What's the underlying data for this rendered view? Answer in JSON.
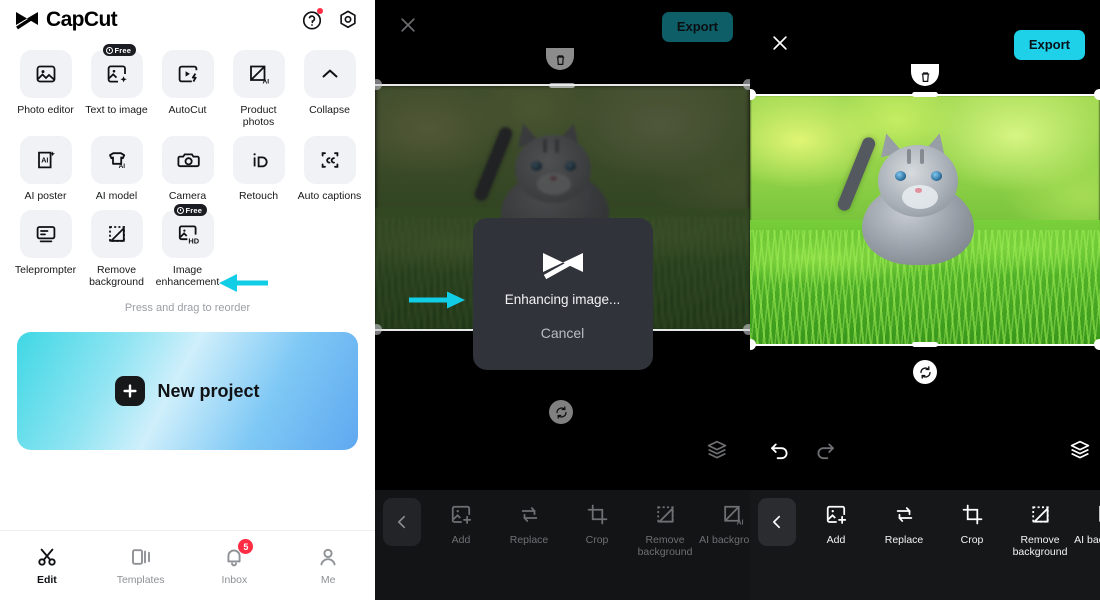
{
  "app": {
    "name": "CapCut"
  },
  "home": {
    "header": {
      "logo_text": "CapCut",
      "help_icon": "help-circle-icon",
      "settings_icon": "settings-hexagon-icon"
    },
    "tools": [
      {
        "label": "Photo editor",
        "icon": "photo-editor-icon",
        "badge": ""
      },
      {
        "label": "Text to image",
        "icon": "text-to-image-icon",
        "badge": "Free"
      },
      {
        "label": "AutoCut",
        "icon": "autocut-icon",
        "badge": ""
      },
      {
        "label": "Product photos",
        "icon": "product-photos-icon",
        "badge": ""
      },
      {
        "label": "Collapse",
        "icon": "chevron-up-icon",
        "badge": ""
      },
      {
        "label": "AI poster",
        "icon": "ai-poster-icon",
        "badge": ""
      },
      {
        "label": "AI model",
        "icon": "ai-model-icon",
        "badge": ""
      },
      {
        "label": "Camera",
        "icon": "camera-icon",
        "badge": ""
      },
      {
        "label": "Retouch",
        "icon": "retouch-icon",
        "badge": ""
      },
      {
        "label": "Auto captions",
        "icon": "auto-captions-icon",
        "badge": ""
      },
      {
        "label": "Teleprompter",
        "icon": "teleprompter-icon",
        "badge": ""
      },
      {
        "label": "Remove background",
        "icon": "remove-background-icon",
        "badge": ""
      },
      {
        "label": "Image enhancement",
        "icon": "image-enhancement-hd-icon",
        "badge": "Free"
      }
    ],
    "reorder_hint": "Press and drag to reorder",
    "new_project_label": "New project",
    "bottom_nav": [
      {
        "label": "Edit",
        "icon": "scissors-icon",
        "badge": "",
        "active": true
      },
      {
        "label": "Templates",
        "icon": "templates-icon",
        "badge": "",
        "active": false
      },
      {
        "label": "Inbox",
        "icon": "bell-icon",
        "badge": "5",
        "active": false
      },
      {
        "label": "Me",
        "icon": "person-icon",
        "badge": "",
        "active": false
      }
    ]
  },
  "editor_processing": {
    "close_label": "close-icon",
    "export_label": "Export",
    "modal": {
      "status_text": "Enhancing image...",
      "cancel_label": "Cancel",
      "logo_icon": "capcut-logo-icon"
    },
    "canvas_icons": [
      "layers-icon"
    ],
    "toolbar": [
      {
        "label": "Add",
        "icon": "add-image-icon"
      },
      {
        "label": "Replace",
        "icon": "replace-icon"
      },
      {
        "label": "Crop",
        "icon": "crop-icon"
      },
      {
        "label": "Remove background",
        "icon": "remove-background-icon"
      },
      {
        "label": "AI background",
        "icon": "ai-background-icon"
      }
    ],
    "back_icon": "chevron-left-icon"
  },
  "editor_result": {
    "close_label": "close-icon",
    "export_label": "Export",
    "canvas_icons": [
      "undo-icon",
      "redo-icon",
      "layers-icon"
    ],
    "toolbar": [
      {
        "label": "Add",
        "icon": "add-image-icon"
      },
      {
        "label": "Replace",
        "icon": "replace-icon"
      },
      {
        "label": "Crop",
        "icon": "crop-icon"
      },
      {
        "label": "Remove background",
        "icon": "remove-background-icon"
      },
      {
        "label": "AI background",
        "icon": "ai-background-icon"
      }
    ],
    "back_icon": "chevron-left-icon"
  },
  "annotations": {
    "arrow_color": "#12CDE6",
    "arrows": [
      {
        "name": "arrow-to-image-enhancement",
        "points_to": "Image enhancement"
      },
      {
        "name": "arrow-to-next-screen",
        "points_to": "processing screen"
      }
    ]
  },
  "colors": {
    "accent_cyan": "#1ed0e8",
    "badge_red": "#ff2c44",
    "tile_gray": "#f0f2f5",
    "dark_panel": "#161719"
  }
}
